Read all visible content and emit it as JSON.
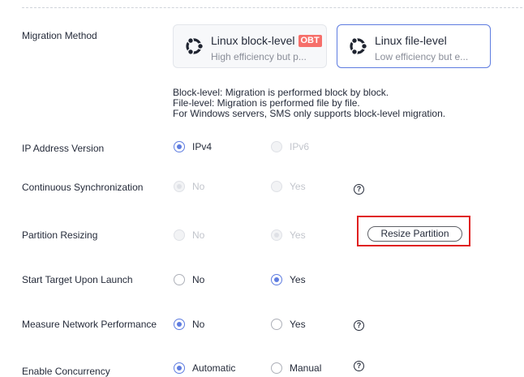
{
  "migration": {
    "label": "Migration Method",
    "options": [
      {
        "title": "Linux block-level",
        "badge": "OBT",
        "desc": "High efficiency but p..."
      },
      {
        "title": "Linux file-level",
        "desc": "Low efficiency but e..."
      }
    ],
    "notes": [
      "Block-level: Migration is performed block by block.",
      "File-level: Migration is performed file by file.",
      "For Windows servers, SMS only supports block-level migration."
    ]
  },
  "ip_version": {
    "label": "IP Address Version",
    "options": [
      "IPv4",
      "IPv6"
    ],
    "selected": "IPv4"
  },
  "continuous_sync": {
    "label": "Continuous Synchronization",
    "options": [
      "No",
      "Yes"
    ],
    "selected": "No"
  },
  "partition_resizing": {
    "label": "Partition Resizing",
    "options": [
      "No",
      "Yes"
    ],
    "selected": "Yes",
    "button": "Resize Partition"
  },
  "start_target": {
    "label": "Start Target Upon Launch",
    "options": [
      "No",
      "Yes"
    ],
    "selected": "Yes"
  },
  "network_perf": {
    "label": "Measure Network Performance",
    "options": [
      "No",
      "Yes"
    ],
    "selected": "No"
  },
  "concurrency": {
    "label": "Enable Concurrency",
    "options": [
      "Automatic",
      "Manual"
    ],
    "selected": "Automatic"
  },
  "help_glyph": "?",
  "colors": {
    "accent": "#5e7ce0",
    "badge": "#f66f6a",
    "highlight": "#e02020"
  }
}
